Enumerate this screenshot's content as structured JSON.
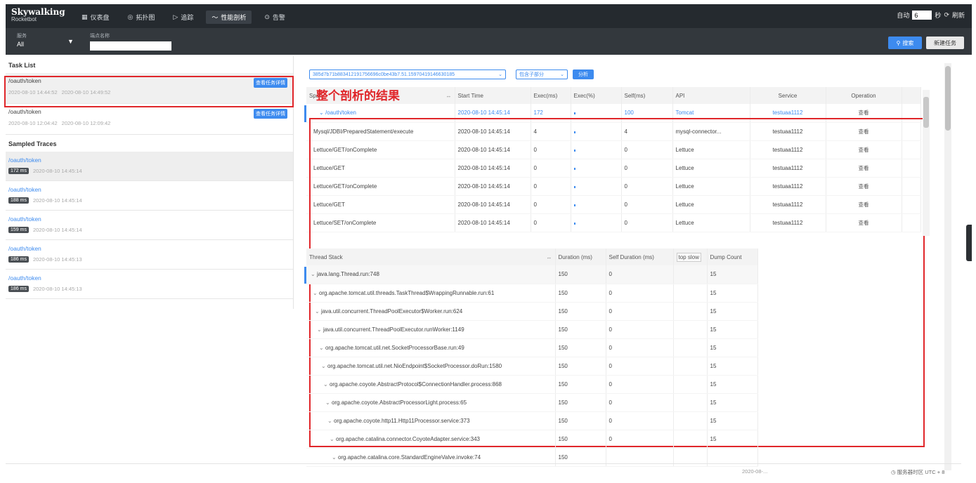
{
  "header": {
    "logo_title": "Skywalking",
    "logo_sub": "Rocketbot",
    "nav": [
      {
        "label": "仪表盘",
        "icon": "dashboard-icon",
        "glyph": "▦"
      },
      {
        "label": "拓扑图",
        "icon": "topology-icon",
        "glyph": "◎"
      },
      {
        "label": "追踪",
        "icon": "trace-icon",
        "glyph": "▷"
      },
      {
        "label": "性能剖析",
        "icon": "profile-icon",
        "glyph": "〜",
        "active": true
      },
      {
        "label": "告警",
        "icon": "alarm-icon",
        "glyph": "⊙"
      }
    ],
    "auto_label": "自动",
    "interval_value": "6",
    "seconds_label": "秒",
    "refresh_label": "刷新"
  },
  "filters": {
    "service_label": "服务",
    "service_value": "All",
    "endpoint_label": "端点名称",
    "endpoint_value": "",
    "search_label": "搜索",
    "new_task_label": "新建任务"
  },
  "task_list": {
    "title": "Task List",
    "view_details_label": "查看任务详情",
    "tasks": [
      {
        "name": "/oauth/token",
        "start": "2020-08-10 14:44:52",
        "end": "2020-08-10 14:49:52"
      },
      {
        "name": "/oauth/token",
        "start": "2020-08-10 12:04:42",
        "end": "2020-08-10 12:09:42"
      }
    ]
  },
  "sampled_traces": {
    "title": "Sampled Traces",
    "traces": [
      {
        "name": "/oauth/token",
        "duration": "172 ms",
        "time": "2020-08-10 14:45:14"
      },
      {
        "name": "/oauth/token",
        "duration": "188 ms",
        "time": "2020-08-10 14:45:14"
      },
      {
        "name": "/oauth/token",
        "duration": "159 ms",
        "time": "2020-08-10 14:45:14"
      },
      {
        "name": "/oauth/token",
        "duration": "186 ms",
        "time": "2020-08-10 14:45:13"
      },
      {
        "name": "/oauth/token",
        "duration": "186 ms",
        "time": "2020-08-10 14:45:13"
      }
    ]
  },
  "analysis": {
    "segment_id": "385d7b71b883412191756696c0be43b7.51.15970419146630185",
    "mode_label": "包含子部分",
    "analyze_label": "分析",
    "annotation": "整个剖析的结果"
  },
  "span_table": {
    "headers": {
      "span": "Span",
      "start": "Start Time",
      "exec": "Exec(ms)",
      "exec_pct": "Exec(%)",
      "self": "Self(ms)",
      "api": "API",
      "service": "Service",
      "operation": "Operation"
    },
    "rows": [
      {
        "span": "/oauth/token",
        "start": "2020-08-10 14:45:14",
        "exec": "172",
        "self": "100",
        "api": "Tomcat",
        "service": "testuaa1112",
        "op": "查看",
        "link": true
      },
      {
        "span": "Mysql/JDBI/PreparedStatement/execute",
        "start": "2020-08-10 14:45:14",
        "exec": "4",
        "self": "4",
        "api": "mysql-connector...",
        "service": "testuaa1112",
        "op": "查看"
      },
      {
        "span": "Lettuce/GET/onComplete",
        "start": "2020-08-10 14:45:14",
        "exec": "0",
        "self": "0",
        "api": "Lettuce",
        "service": "testuaa1112",
        "op": "查看"
      },
      {
        "span": "Lettuce/GET",
        "start": "2020-08-10 14:45:14",
        "exec": "0",
        "self": "0",
        "api": "Lettuce",
        "service": "testuaa1112",
        "op": "查看"
      },
      {
        "span": "Lettuce/GET/onComplete",
        "start": "2020-08-10 14:45:14",
        "exec": "0",
        "self": "0",
        "api": "Lettuce",
        "service": "testuaa1112",
        "op": "查看"
      },
      {
        "span": "Lettuce/GET",
        "start": "2020-08-10 14:45:14",
        "exec": "0",
        "self": "0",
        "api": "Lettuce",
        "service": "testuaa1112",
        "op": "查看"
      },
      {
        "span": "Lettuce/SET/onComplete",
        "start": "2020-08-10 14:45:14",
        "exec": "0",
        "self": "0",
        "api": "Lettuce",
        "service": "testuaa1112",
        "op": "查看"
      }
    ]
  },
  "thread_stack": {
    "headers": {
      "stack": "Thread Stack",
      "duration": "Duration (ms)",
      "self": "Self Duration (ms)",
      "top_slow": "top slow",
      "dump": "Dump Count"
    },
    "rows": [
      {
        "frame": "java.lang.Thread.run:748",
        "duration": "150",
        "self": "0",
        "dump": "15"
      },
      {
        "frame": "org.apache.tomcat.util.threads.TaskThread$WrappingRunnable.run:61",
        "duration": "150",
        "self": "0",
        "dump": "15"
      },
      {
        "frame": "java.util.concurrent.ThreadPoolExecutor$Worker.run:624",
        "duration": "150",
        "self": "0",
        "dump": "15"
      },
      {
        "frame": "java.util.concurrent.ThreadPoolExecutor.runWorker:1149",
        "duration": "150",
        "self": "0",
        "dump": "15"
      },
      {
        "frame": "org.apache.tomcat.util.net.SocketProcessorBase.run:49",
        "duration": "150",
        "self": "0",
        "dump": "15"
      },
      {
        "frame": "org.apache.tomcat.util.net.NioEndpoint$SocketProcessor.doRun:1580",
        "duration": "150",
        "self": "0",
        "dump": "15"
      },
      {
        "frame": "org.apache.coyote.AbstractProtocol$ConnectionHandler.process:868",
        "duration": "150",
        "self": "0",
        "dump": "15"
      },
      {
        "frame": "org.apache.coyote.AbstractProcessorLight.process:65",
        "duration": "150",
        "self": "0",
        "dump": "15"
      },
      {
        "frame": "org.apache.coyote.http11.Http11Processor.service:373",
        "duration": "150",
        "self": "0",
        "dump": "15"
      },
      {
        "frame": "org.apache.catalina.connector.CoyoteAdapter.service:343",
        "duration": "150",
        "self": "0",
        "dump": "15"
      },
      {
        "frame": "org.apache.catalina.core.StandardEngineValve.invoke:74",
        "duration": "150",
        "self": "",
        "dump": ""
      }
    ]
  },
  "footer": {
    "time_text": "2020-08-...",
    "timezone_label": "服务器时区",
    "timezone_value": "UTC + 8"
  }
}
